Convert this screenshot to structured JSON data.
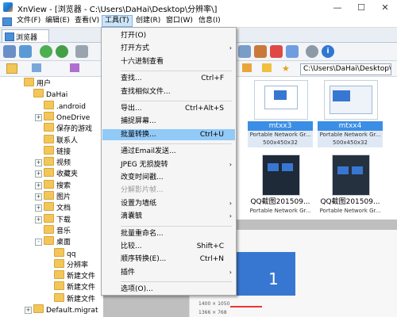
{
  "window": {
    "title": "XnView - [浏览器 - C:\\Users\\DaHai\\Desktop\\分辨率\\]",
    "minimize": "—",
    "maximize": "☐",
    "close": "✕"
  },
  "menubar": [
    "文件(F)",
    "编辑(E)",
    "查看(V)",
    "工具(T)",
    "创建(R)",
    "窗口(W)",
    "信息(I)"
  ],
  "tab": {
    "label": "浏览器"
  },
  "path": {
    "value": "C:\\Users\\DaHai\\Desktop\\"
  },
  "tree": [
    {
      "label": "用户",
      "expander": ""
    },
    {
      "label": "DaHai",
      "expander": ""
    },
    {
      "label": ".android",
      "expander": ""
    },
    {
      "label": "OneDrive",
      "expander": "+"
    },
    {
      "label": "保存的游戏",
      "expander": ""
    },
    {
      "label": "联系人",
      "expander": ""
    },
    {
      "label": "链接",
      "expander": ""
    },
    {
      "label": "视频",
      "expander": "+"
    },
    {
      "label": "收藏夹",
      "expander": "+"
    },
    {
      "label": "搜索",
      "expander": "+"
    },
    {
      "label": "图片",
      "expander": "+"
    },
    {
      "label": "文档",
      "expander": "+"
    },
    {
      "label": "下载",
      "expander": "+"
    },
    {
      "label": "音乐",
      "expander": ""
    },
    {
      "label": "桌面",
      "expander": "-"
    },
    {
      "label": "qq",
      "expander": ""
    },
    {
      "label": "分辨率",
      "expander": ""
    },
    {
      "label": "新建文件",
      "expander": ""
    },
    {
      "label": "新建文件",
      "expander": ""
    },
    {
      "label": "新建文件",
      "expander": ""
    },
    {
      "label": "Default.migrat",
      "expander": "+"
    }
  ],
  "thumbnails": [
    {
      "name": "mtxx3",
      "type": "Portable Network Gr...",
      "size": "500x450x32",
      "selected": true
    },
    {
      "name": "mtxx4",
      "type": "Portable Network Gr...",
      "size": "500x450x32",
      "selected": true
    },
    {
      "name": "QQ截图201509...",
      "type": "Portable Network Gr...",
      "size": "",
      "selected": false
    },
    {
      "name": "QQ截图201509...",
      "type": "Portable Network Gr...",
      "size": "",
      "selected": false
    }
  ],
  "preview": {
    "big_number": "1",
    "line1": "1400 × 1050",
    "line2": "1366 × 768"
  },
  "tools_menu": [
    {
      "label": "打开(O)",
      "shortcut": "",
      "submenu": false,
      "sep_before": false
    },
    {
      "label": "打开方式",
      "shortcut": "",
      "submenu": true,
      "sep_before": false
    },
    {
      "label": "十六进制查看",
      "shortcut": "",
      "submenu": false,
      "sep_before": false
    },
    {
      "label": "查找...",
      "shortcut": "Ctrl+F",
      "submenu": false,
      "sep_before": true
    },
    {
      "label": "查找相似文件...",
      "shortcut": "",
      "submenu": false,
      "sep_before": false
    },
    {
      "label": "导出...",
      "shortcut": "Ctrl+Alt+S",
      "submenu": false,
      "sep_before": true
    },
    {
      "label": "捕捉屏幕...",
      "shortcut": "",
      "submenu": false,
      "sep_before": false
    },
    {
      "label": "批量转换...",
      "shortcut": "Ctrl+U",
      "submenu": false,
      "sep_before": false,
      "highlighted": true
    },
    {
      "label": "通过Email发送...",
      "shortcut": "",
      "submenu": false,
      "sep_before": true
    },
    {
      "label": "JPEG 无损旋转",
      "shortcut": "",
      "submenu": true,
      "sep_before": false
    },
    {
      "label": "改变时间戳...",
      "shortcut": "",
      "submenu": false,
      "sep_before": false
    },
    {
      "label": "分解影片帧...",
      "shortcut": "",
      "submenu": false,
      "sep_before": false,
      "disabled": true
    },
    {
      "label": "设置为墙纸",
      "shortcut": "",
      "submenu": true,
      "sep_before": false
    },
    {
      "label": "滴囊毓",
      "shortcut": "",
      "submenu": true,
      "sep_before": false
    },
    {
      "label": "批量重命名...",
      "shortcut": "",
      "submenu": false,
      "sep_before": true
    },
    {
      "label": "比较...",
      "shortcut": "Shift+C",
      "submenu": false,
      "sep_before": false
    },
    {
      "label": "顺序转换(E)...",
      "shortcut": "Ctrl+N",
      "submenu": false,
      "sep_before": false
    },
    {
      "label": "插件",
      "shortcut": "",
      "submenu": true,
      "sep_before": false
    },
    {
      "label": "选项(O)...",
      "shortcut": "",
      "submenu": false,
      "sep_before": true
    }
  ],
  "colors": {
    "highlight": "#91c9f7",
    "selection": "#3a8ee6",
    "folder": "#f3c65a"
  }
}
